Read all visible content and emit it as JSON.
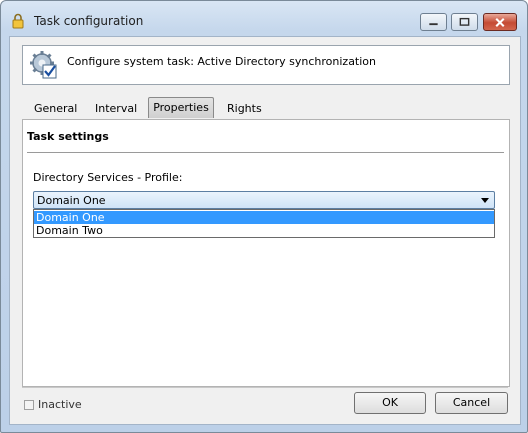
{
  "window": {
    "title": "Task configuration",
    "icons": {
      "title": "lock-icon",
      "header": "gear-check-icon"
    }
  },
  "header": {
    "text": "Configure system task: Active Directory synchronization"
  },
  "tabs": [
    {
      "label": "General"
    },
    {
      "label": "Interval"
    },
    {
      "label": "Properties",
      "active": true
    },
    {
      "label": "Rights"
    }
  ],
  "section": {
    "title": "Task settings"
  },
  "field": {
    "label": "Directory Services - Profile:",
    "selected": "Domain One",
    "options": [
      "Domain One",
      "Domain Two"
    ]
  },
  "footer": {
    "inactive_label": "Inactive",
    "inactive_checked": false,
    "ok_label": "OK",
    "cancel_label": "Cancel"
  },
  "colors": {
    "selection": "#3399ff",
    "close_button": "#c54a33"
  }
}
